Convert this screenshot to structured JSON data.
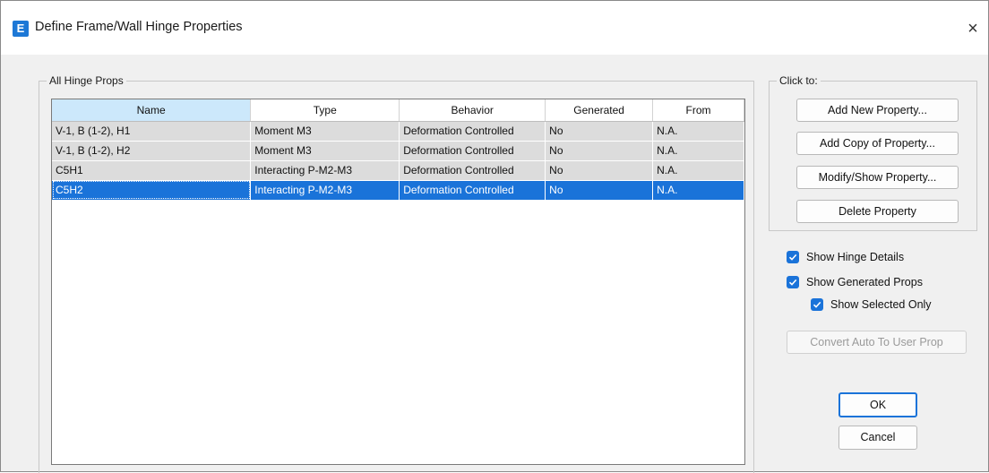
{
  "window": {
    "app_icon_letter": "E",
    "title": "Define Frame/Wall Hinge Properties",
    "close_glyph": "×"
  },
  "left_group": {
    "label": "All Hinge Props",
    "table": {
      "columns": [
        "Name",
        "Type",
        "Behavior",
        "Generated",
        "From"
      ],
      "rows": [
        [
          "V-1, B (1-2), H1",
          "Moment M3",
          "Deformation Controlled",
          "No",
          "N.A."
        ],
        [
          "V-1, B (1-2), H2",
          "Moment M3",
          "Deformation Controlled",
          "No",
          "N.A."
        ],
        [
          "C5H1",
          "Interacting P-M2-M3",
          "Deformation Controlled",
          "No",
          "N.A."
        ],
        [
          "C5H2",
          "Interacting P-M2-M3",
          "Deformation Controlled",
          "No",
          "N.A."
        ]
      ],
      "selected_row_index": 3
    }
  },
  "right_group": {
    "label": "Click to:",
    "add_new": "Add New Property...",
    "add_copy": "Add Copy of Property...",
    "modify_show": "Modify/Show Property...",
    "delete": "Delete Property"
  },
  "options": {
    "show_hinge_details": "Show Hinge Details",
    "show_generated_props": "Show Generated Props",
    "show_selected_only": "Show Selected Only",
    "convert": "Convert Auto To User Prop"
  },
  "actions": {
    "ok": "OK",
    "cancel": "Cancel"
  },
  "colors": {
    "accent": "#1a73d9",
    "row_bg": "#dcdcdc",
    "header_sorted": "#cce8fb"
  }
}
